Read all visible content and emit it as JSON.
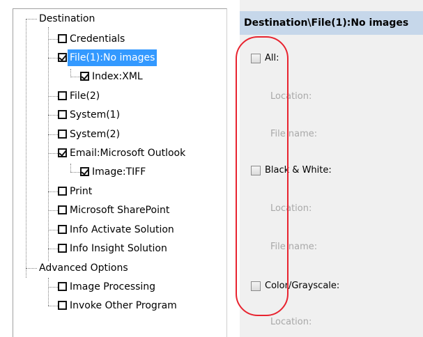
{
  "tree": {
    "destination": "Destination",
    "credentials": "Credentials",
    "file1": "File(1):No images",
    "index_xml": "Index:XML",
    "file2": "File(2)",
    "system1": "System(1)",
    "system2": "System(2)",
    "email_outlook": "Email:Microsoft Outlook",
    "image_tiff": "Image:TIFF",
    "print": "Print",
    "sharepoint": "Microsoft SharePoint",
    "info_activate": "Info Activate Solution",
    "info_insight": "Info Insight Solution",
    "advanced_options": "Advanced Options",
    "image_processing": "Image Processing",
    "invoke_program": "Invoke Other Program"
  },
  "checks": {
    "credentials": false,
    "file1": true,
    "index_xml": true,
    "file2": false,
    "system1": false,
    "system2": false,
    "email_outlook": true,
    "image_tiff": true,
    "print": false,
    "sharepoint": false,
    "info_activate": false,
    "info_insight": false,
    "image_processing": false,
    "invoke_program": false
  },
  "detail": {
    "header": "Destination\\File(1):No images",
    "all_label": "All:",
    "bw_label": "Black & White:",
    "color_label": "Color/Grayscale:",
    "location_label": "Location:",
    "file_name_label": "File name:"
  },
  "colors": {
    "selection": "#3399ff",
    "header_bg": "#c6d7ea",
    "highlight": "#e8232f"
  }
}
